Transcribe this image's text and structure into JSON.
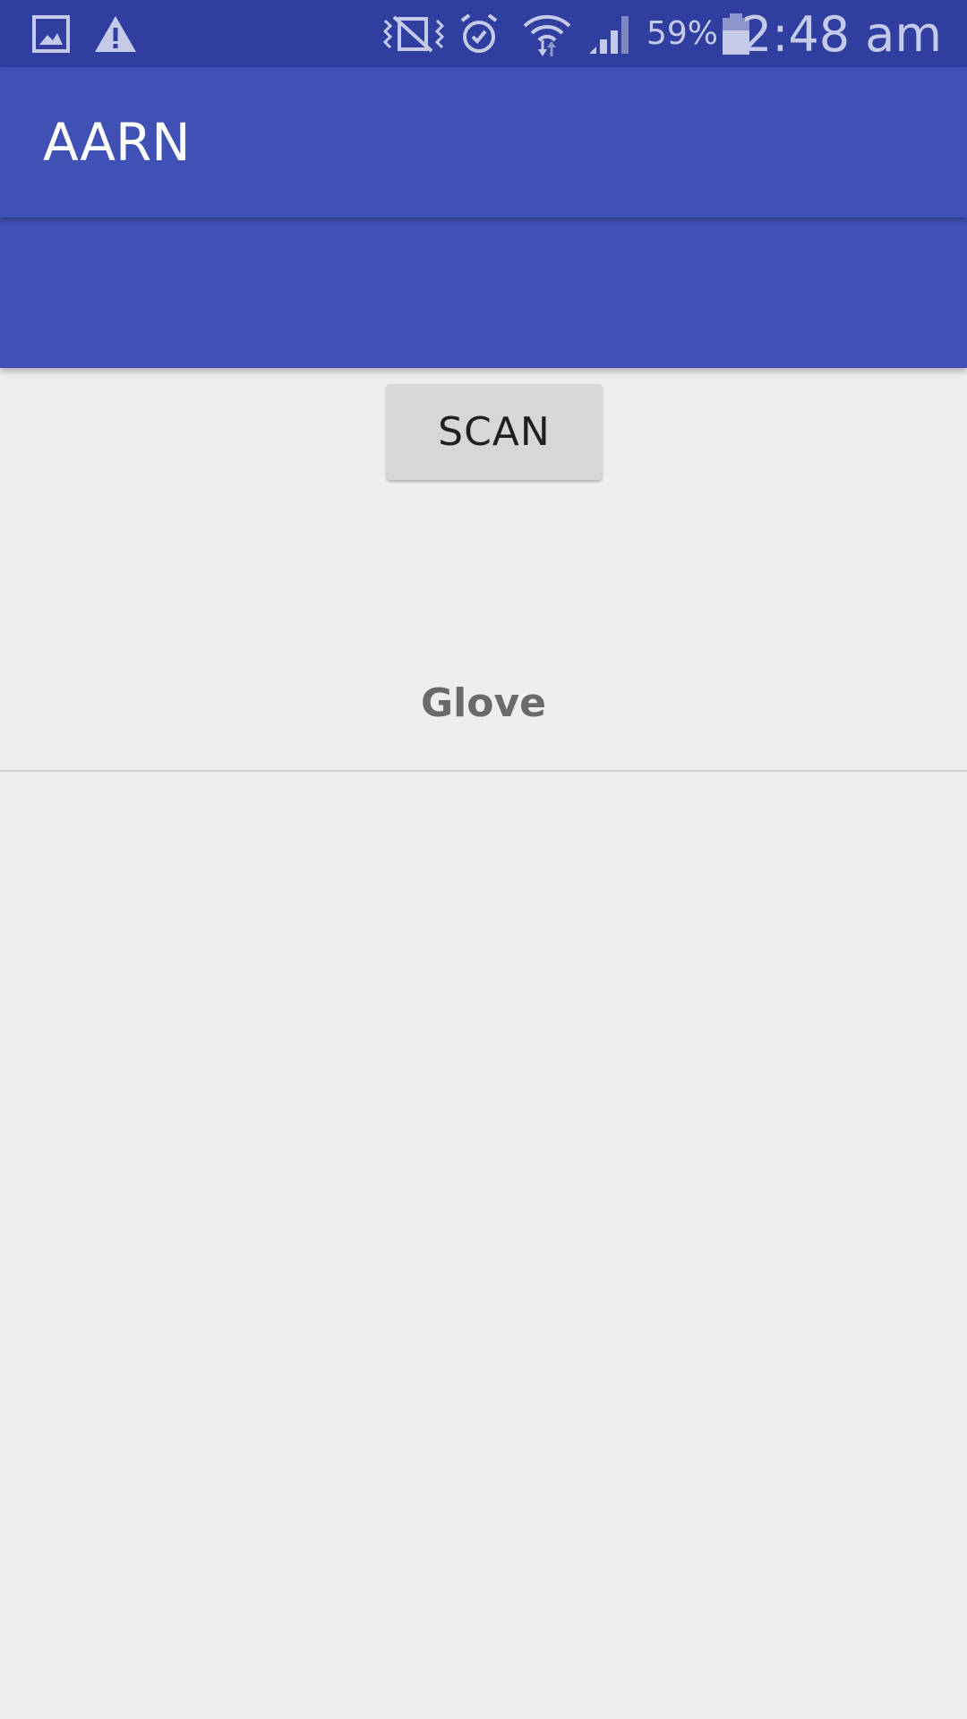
{
  "status_bar": {
    "icons": [
      "gallery-icon",
      "warning-icon",
      "vibrate-icon",
      "alarm-icon",
      "wifi-icon",
      "signal-icon",
      "battery-icon"
    ],
    "battery_percent": "59%",
    "time": "2:48 am"
  },
  "app_bar": {
    "title": "AARN"
  },
  "main": {
    "scan_button_label": "SCAN",
    "device_list": [
      {
        "label": "Glove"
      }
    ]
  },
  "colors": {
    "status_bar": "#303f9f",
    "primary": "#3f51b5",
    "background": "#eeeeee",
    "button": "#d6d7d7"
  }
}
